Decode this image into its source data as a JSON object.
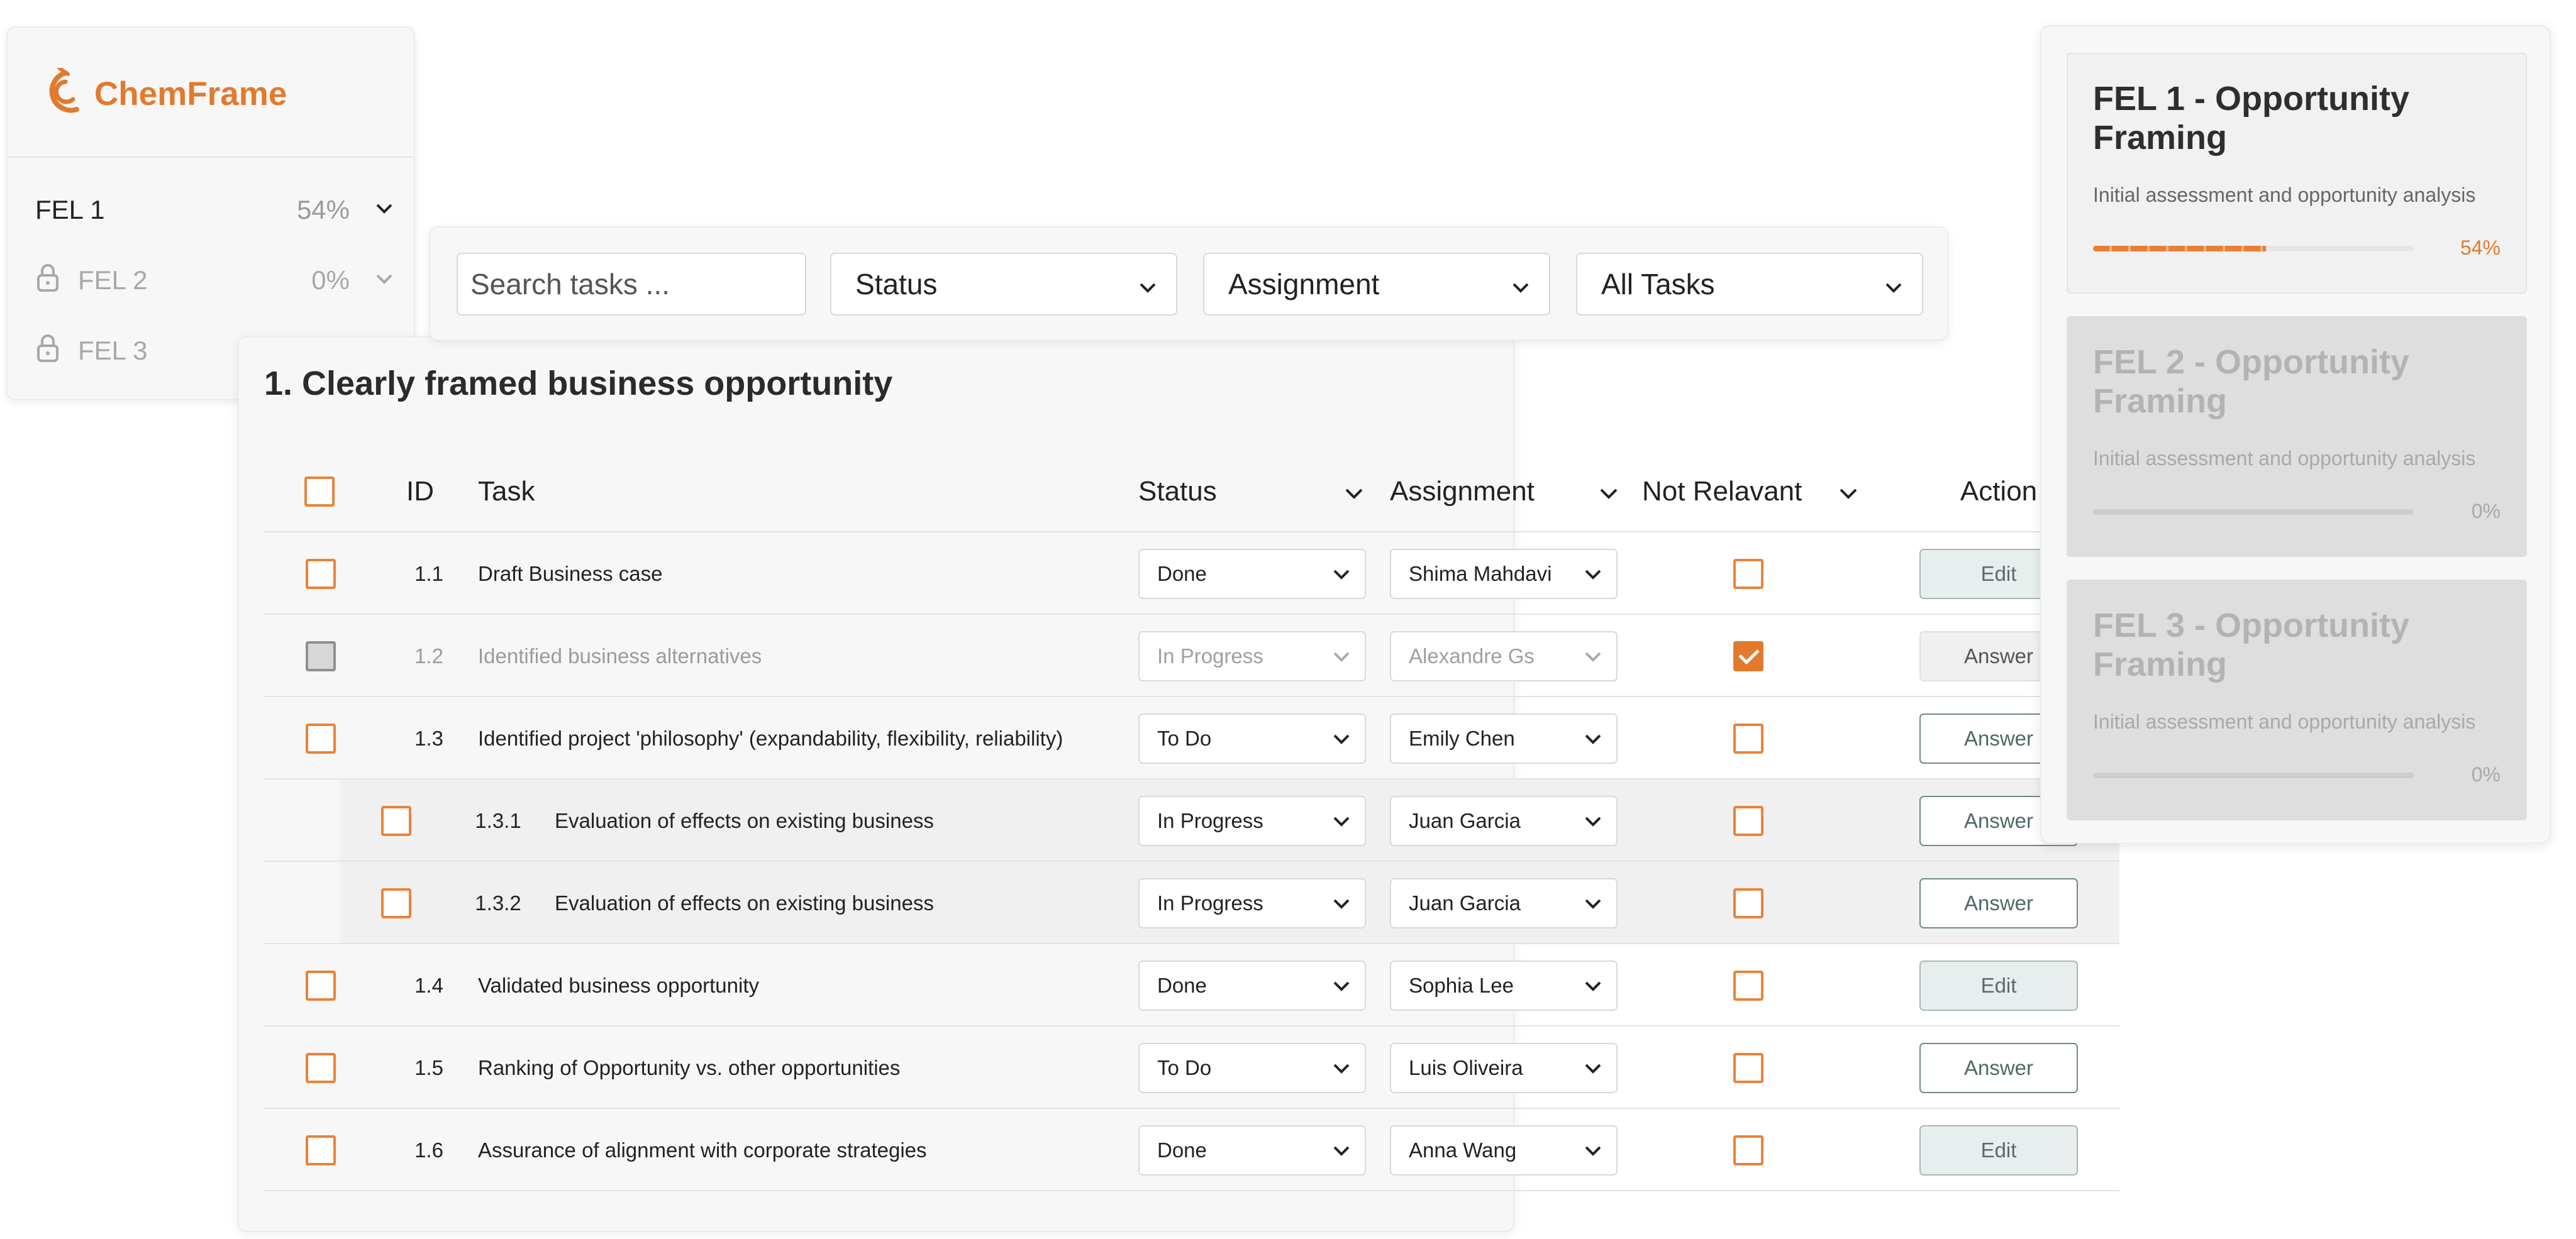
{
  "app": {
    "name": "ChemFrame"
  },
  "colors": {
    "accent": "#e27a2e",
    "teal": "#4f6967"
  },
  "sidebar": {
    "items": [
      {
        "label": "FEL 1",
        "percent": "54%",
        "locked": false,
        "icon": "chevron-down-icon"
      },
      {
        "label": "FEL 2",
        "percent": "0%",
        "locked": true,
        "icon": "lock-icon"
      },
      {
        "label": "FEL 3",
        "percent": "",
        "locked": true,
        "icon": "lock-icon"
      }
    ]
  },
  "filters": {
    "search_placeholder": "Search tasks ...",
    "status": "Status",
    "assignment": "Assignment",
    "scope": "All Tasks"
  },
  "section": {
    "title": "1. Clearly framed business opportunity"
  },
  "table": {
    "headers": {
      "id": "ID",
      "task": "Task",
      "status": "Status",
      "assignment": "Assignment",
      "not_relevant": "Not Relavant",
      "action": "Action"
    },
    "rows": [
      {
        "id": "1.1",
        "task": "Draft Business case",
        "status": "Done",
        "assignee": "Shima Mahdavi",
        "not_relevant": false,
        "action": "Edit",
        "muted": false,
        "sub": false
      },
      {
        "id": "1.2",
        "task": "Identified business alternatives",
        "status": "In Progress",
        "assignee": "Alexandre Gs",
        "not_relevant": true,
        "action": "Answer",
        "muted": true,
        "sub": false
      },
      {
        "id": "1.3",
        "task": "Identified project 'philosophy' (expandability, flexibility, reliability)",
        "status": "To Do",
        "assignee": "Emily Chen",
        "not_relevant": false,
        "action": "Answer",
        "muted": false,
        "sub": false
      },
      {
        "id": "1.3.1",
        "task": "Evaluation of effects on existing business",
        "status": "In Progress",
        "assignee": "Juan Garcia",
        "not_relevant": false,
        "action": "Answer",
        "muted": false,
        "sub": true
      },
      {
        "id": "1.3.2",
        "task": "Evaluation of effects on existing business",
        "status": "In Progress",
        "assignee": "Juan Garcia",
        "not_relevant": false,
        "action": "Answer",
        "muted": false,
        "sub": true
      },
      {
        "id": "1.4",
        "task": "Validated business opportunity",
        "status": "Done",
        "assignee": "Sophia Lee",
        "not_relevant": false,
        "action": "Edit",
        "muted": false,
        "sub": false
      },
      {
        "id": "1.5",
        "task": "Ranking of Opportunity vs. other opportunities",
        "status": "To Do",
        "assignee": "Luis Oliveira",
        "not_relevant": false,
        "action": "Answer",
        "muted": false,
        "sub": false
      },
      {
        "id": "1.6",
        "task": "Assurance of alignment with corporate strategies",
        "status": "Done",
        "assignee": "Anna Wang",
        "not_relevant": false,
        "action": "Edit",
        "muted": false,
        "sub": false
      }
    ]
  },
  "phases": [
    {
      "title": "FEL 1 - Opportunity Framing",
      "subtitle": "Initial assessment and opportunity analysis",
      "percent": "54%",
      "progress": 0.54,
      "active": true
    },
    {
      "title": "FEL 2 - Opportunity Framing",
      "subtitle": "Initial assessment and opportunity analysis",
      "percent": "0%",
      "progress": 0,
      "active": false
    },
    {
      "title": "FEL 3 - Opportunity Framing",
      "subtitle": "Initial assessment and opportunity analysis",
      "percent": "0%",
      "progress": 0,
      "active": false
    }
  ]
}
